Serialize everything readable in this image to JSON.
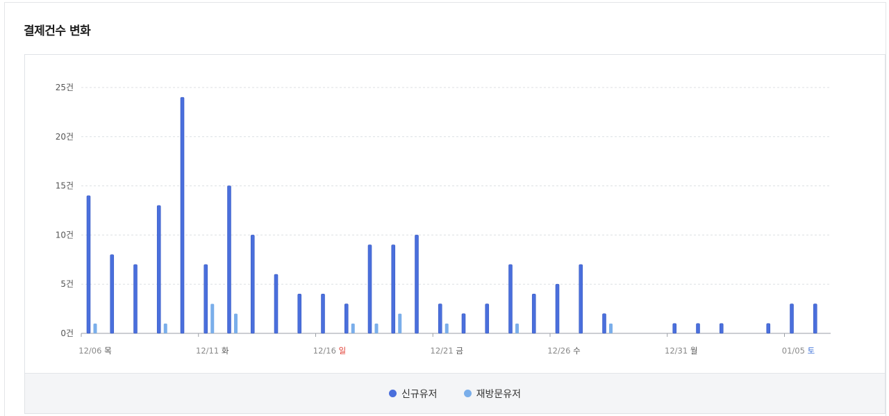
{
  "title": "결제건수 변화",
  "colors": {
    "new_user": "#4a6fdc",
    "revisit_user": "#7aaeea",
    "sunday": "#e03a2f",
    "saturday": "#3a6fd8",
    "weekday": "#555555"
  },
  "legend": [
    {
      "label": "신규유저",
      "color": "#4a6fdc"
    },
    {
      "label": "재방문유저",
      "color": "#7aaeea"
    }
  ],
  "chart_data": {
    "type": "bar",
    "y_unit": "건",
    "ylim": [
      0,
      25
    ],
    "yticks": [
      "0건",
      "5건",
      "10건",
      "15건",
      "20건",
      "25건"
    ],
    "grid": true,
    "legend_position": "bottom",
    "categories": [
      "12/06",
      "12/07",
      "12/08",
      "12/09",
      "12/10",
      "12/11",
      "12/12",
      "12/13",
      "12/14",
      "12/15",
      "12/16",
      "12/17",
      "12/18",
      "12/19",
      "12/20",
      "12/21",
      "12/22",
      "12/23",
      "12/24",
      "12/25",
      "12/26",
      "12/27",
      "12/28",
      "12/29",
      "12/30",
      "12/31",
      "01/01",
      "01/02",
      "01/03",
      "01/04",
      "01/05",
      "01/06"
    ],
    "x_tick_labels": [
      {
        "date": "12/06",
        "day": "목",
        "kind": "weekday"
      },
      {
        "date": "12/11",
        "day": "화",
        "kind": "weekday"
      },
      {
        "date": "12/16",
        "day": "일",
        "kind": "sunday"
      },
      {
        "date": "12/21",
        "day": "금",
        "kind": "weekday"
      },
      {
        "date": "12/26",
        "day": "수",
        "kind": "weekday"
      },
      {
        "date": "12/31",
        "day": "월",
        "kind": "weekday"
      },
      {
        "date": "01/05",
        "day": "토",
        "kind": "saturday"
      }
    ],
    "series": [
      {
        "name": "신규유저",
        "values": [
          14,
          8,
          7,
          13,
          24,
          7,
          15,
          10,
          6,
          4,
          4,
          3,
          9,
          9,
          10,
          3,
          2,
          3,
          7,
          4,
          5,
          7,
          2,
          0,
          0,
          1,
          1,
          1,
          0,
          1,
          3,
          3
        ]
      },
      {
        "name": "재방문유저",
        "values": [
          1,
          0,
          0,
          1,
          0,
          3,
          2,
          0,
          0,
          0,
          0,
          1,
          1,
          2,
          0,
          1,
          0,
          0,
          1,
          0,
          0,
          0,
          1,
          0,
          0,
          0,
          0,
          0,
          0,
          0,
          0,
          0
        ]
      }
    ]
  }
}
